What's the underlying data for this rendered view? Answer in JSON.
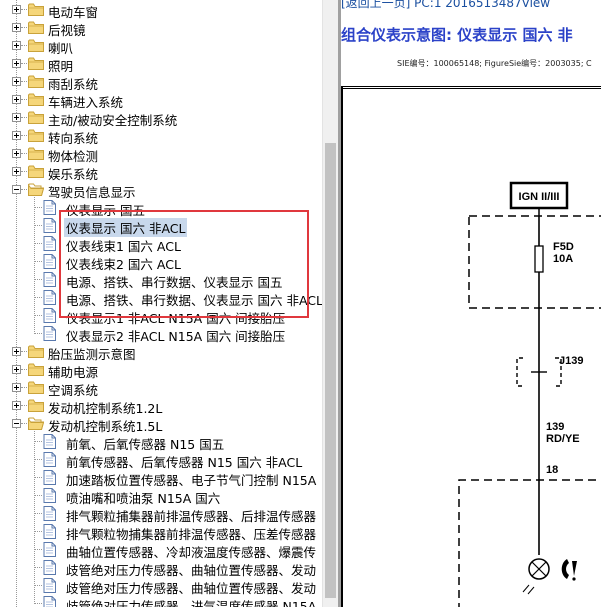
{
  "tree": {
    "items": [
      {
        "label": "电动车窗",
        "type": "folder",
        "expanded": false
      },
      {
        "label": "后视镜",
        "type": "folder",
        "expanded": false
      },
      {
        "label": "喇叭",
        "type": "folder",
        "expanded": false
      },
      {
        "label": "照明",
        "type": "folder",
        "expanded": false
      },
      {
        "label": "雨刮系统",
        "type": "folder",
        "expanded": false
      },
      {
        "label": "车辆进入系统",
        "type": "folder",
        "expanded": false
      },
      {
        "label": "主动/被动安全控制系统",
        "type": "folder",
        "expanded": false
      },
      {
        "label": "转向系统",
        "type": "folder",
        "expanded": false
      },
      {
        "label": "物体检测",
        "type": "folder",
        "expanded": false
      },
      {
        "label": "娱乐系统",
        "type": "folder",
        "expanded": false
      },
      {
        "label": "驾驶员信息显示",
        "type": "folder",
        "expanded": true
      },
      {
        "label": "仪表显示 国五",
        "type": "doc"
      },
      {
        "label": "仪表显示 国六 非ACL",
        "type": "doc",
        "selected": true
      },
      {
        "label": "仪表线束1 国六 ACL",
        "type": "doc"
      },
      {
        "label": "仪表线束2 国六 ACL",
        "type": "doc"
      },
      {
        "label": "电源、搭铁、串行数据、仪表显示 国五",
        "type": "doc"
      },
      {
        "label": "电源、搭铁、串行数据、仪表显示 国六 非ACL",
        "type": "doc"
      },
      {
        "label": "仪表显示1 非ACL N15A 国六 间接胎压",
        "type": "doc"
      },
      {
        "label": "仪表显示2 非ACL N15A 国六 间接胎压",
        "type": "doc"
      },
      {
        "label": "胎压监测示意图",
        "type": "folder",
        "expanded": false
      },
      {
        "label": "辅助电源",
        "type": "folder",
        "expanded": false
      },
      {
        "label": "空调系统",
        "type": "folder",
        "expanded": false
      },
      {
        "label": "发动机控制系统1.2L",
        "type": "folder",
        "expanded": false
      },
      {
        "label": "发动机控制系统1.5L",
        "type": "folder",
        "expanded": true
      },
      {
        "label": "前氧、后氧传感器 N15 国五",
        "type": "doc"
      },
      {
        "label": "前氧传感器、后氧传感器 N15 国六 非ACL",
        "type": "doc"
      },
      {
        "label": "加速踏板位置传感器、电子节气门控制 N15A",
        "type": "doc"
      },
      {
        "label": "喷油嘴和喷油泵 N15A 国六",
        "type": "doc"
      },
      {
        "label": "排气颗粒捕集器前排温传感器、后排温传感器",
        "type": "doc"
      },
      {
        "label": "排气颗粒物捕集器前排温传感器、压差传感器",
        "type": "doc"
      },
      {
        "label": "曲轴位置传感器、冷却液温度传感器、爆震传",
        "type": "doc"
      },
      {
        "label": "歧管绝对压力传感器、曲轴位置传感器、发动",
        "type": "doc"
      },
      {
        "label": "歧管绝对压力传感器、曲轴位置传感器、发动",
        "type": "doc"
      },
      {
        "label": "歧管绝对压力传感器、进气温度传感器 N15A",
        "type": "doc"
      }
    ]
  },
  "viewer": {
    "back_link": "[返回上一页] PC:1 2016513487View",
    "title": "组合仪表示意图: 仪表显示 国六 非",
    "meta": "SIE编号：100065148; FigureSie编号：2003035; C",
    "ign_label": "IGN II/III",
    "fuse_label": "F5D",
    "fuse_rating": "10A",
    "connector_label": "J139",
    "circuit_number": "139",
    "wire_color": "RD/YE",
    "pin_number": "18"
  },
  "colors": {
    "title": "#2b42c8",
    "link": "#1a4fa0",
    "highlight_box": "#e0383d",
    "selection": "#c8d8ec",
    "folder_fill": "#f5d67a",
    "folder_stroke": "#c9a23a"
  }
}
